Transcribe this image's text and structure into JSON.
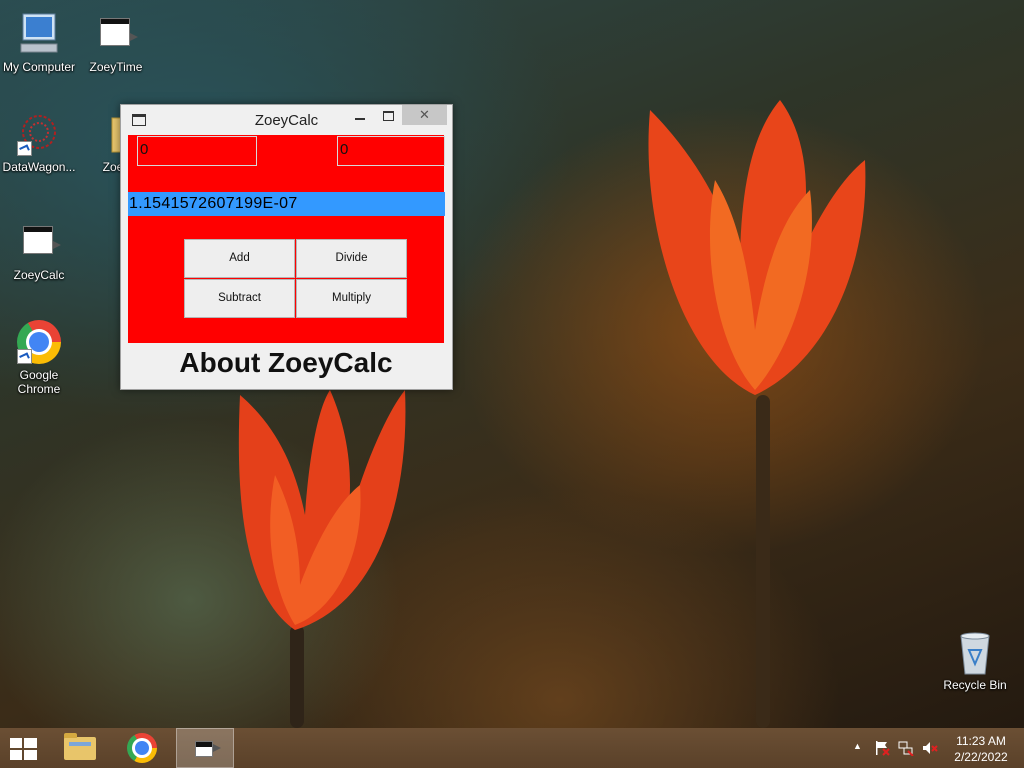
{
  "desktop": {
    "icons": [
      {
        "label": "My Computer",
        "icon": "computer-icon"
      },
      {
        "label": "ZoeyTime",
        "icon": "app-window-icon"
      },
      {
        "label": "DataWagon...",
        "icon": "datawagon-icon"
      },
      {
        "label": "Zoey",
        "icon": "folder-icon"
      },
      {
        "label": "ZoeyCalc",
        "icon": "app-window-icon"
      },
      {
        "label": "Google Chrome",
        "icon": "chrome-icon"
      },
      {
        "label": "Recycle Bin",
        "icon": "recycle-bin-icon"
      }
    ]
  },
  "window": {
    "title": "ZoeyCalc",
    "close_glyph": "✕",
    "input_a": "0",
    "input_b": "0",
    "result": "1.1541572607199E-07",
    "buttons": {
      "add": "Add",
      "divide": "Divide",
      "subtract": "Subtract",
      "multiply": "Multiply"
    },
    "about": "About ZoeyCalc"
  },
  "taskbar": {
    "clock_time": "11:23 AM",
    "clock_date": "2/22/2022",
    "tray_up_arrow": "▲"
  },
  "colors": {
    "calc_background": "#ff0000",
    "result_background": "#3399ff",
    "taskbar": "#5a4129"
  }
}
